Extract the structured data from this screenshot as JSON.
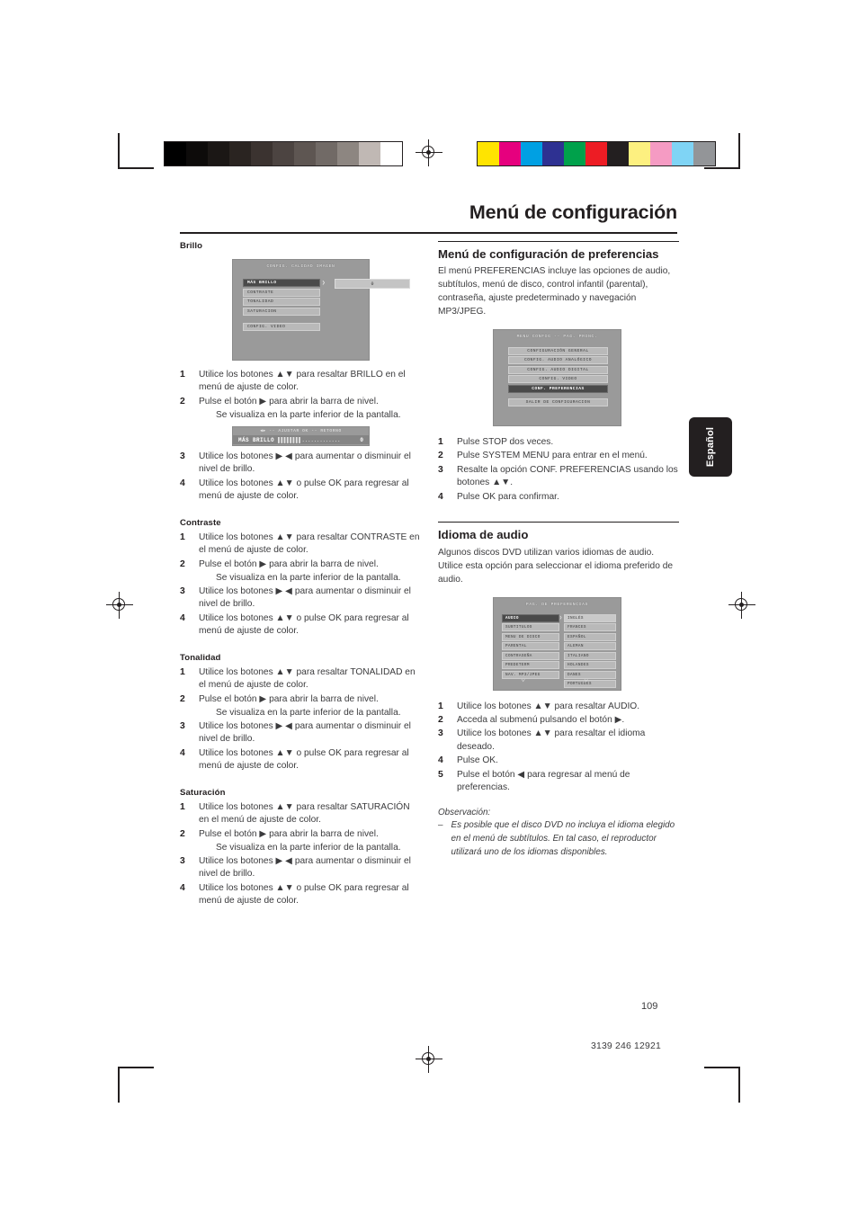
{
  "page": {
    "title": "Menú de configuración",
    "side_tab": "Español",
    "page_number": "109",
    "doc_number": "3139 246 12921"
  },
  "calibration": {
    "gray_bar": [
      "#000000",
      "#0d0b0a",
      "#1b1715",
      "#2a2421",
      "#3b3330",
      "#4c4441",
      "#5e5652",
      "#716a66",
      "#8d8681",
      "#c0b8b4",
      "#ffffff"
    ],
    "color_bar": [
      "#ffe400",
      "#e6007e",
      "#00a0e3",
      "#2e3192",
      "#00a14b",
      "#ed1c24",
      "#231f20",
      "#fdf080",
      "#f59bc3",
      "#7fd4f5",
      "#939598"
    ]
  },
  "left_column": {
    "sections": [
      {
        "heading": "Brillo",
        "figure_top": {
          "title": "CONFIG. CALIDAD IMAGEN",
          "items": [
            "MÁS BRILLO",
            "CONTRASTE",
            "TONALIDAD",
            "SATURACION"
          ],
          "selected_index": 0,
          "value": "0",
          "extra_item": "CONFIG. VIDEO"
        },
        "steps": [
          {
            "num": "1",
            "text": "Utilice los botones ▲▼ para resaltar BRILLO en el menú de ajuste de color."
          },
          {
            "num": "2",
            "text": "Pulse el botón ▶ para abrir la barra de nivel."
          }
        ],
        "substep": "Se visualiza en la parte inferior de la pantalla.",
        "figure_bar": {
          "hint": "◀▶ -- AJUSTAR     OK -- RETORNO",
          "label": "MÁS BRILLO",
          "meter": "▌▌▌▌▌▌▌▌.............",
          "value": "0"
        },
        "steps_after": [
          {
            "num": "3",
            "text": "Utilice los botones ▶ ◀ para aumentar o disminuir el nivel de brillo."
          },
          {
            "num": "4",
            "text": "Utilice los botones ▲▼ o pulse OK para regresar al menú de ajuste de color."
          }
        ]
      },
      {
        "heading": "Contraste",
        "steps": [
          {
            "num": "1",
            "text": "Utilice los botones ▲▼ para resaltar CONTRASTE en el menú de ajuste de color."
          },
          {
            "num": "2",
            "text": "Pulse el botón ▶ para abrir la barra de nivel."
          }
        ],
        "substep": "Se visualiza en la parte inferior de la pantalla.",
        "steps_after": [
          {
            "num": "3",
            "text": "Utilice los botones ▶ ◀ para aumentar o disminuir el nivel de brillo."
          },
          {
            "num": "4",
            "text": "Utilice los botones ▲▼ o pulse OK para regresar al menú de ajuste de color."
          }
        ]
      },
      {
        "heading": "Tonalidad",
        "steps": [
          {
            "num": "1",
            "text": "Utilice los botones ▲▼ para resaltar TONALIDAD en el menú de ajuste de color."
          },
          {
            "num": "2",
            "text": "Pulse el botón ▶ para abrir la barra de nivel."
          }
        ],
        "substep": "Se visualiza en la parte inferior de la pantalla.",
        "steps_after": [
          {
            "num": "3",
            "text": "Utilice los botones ▶ ◀ para aumentar o disminuir el nivel de brillo."
          },
          {
            "num": "4",
            "text": "Utilice los botones ▲▼ o pulse OK para regresar al menú de ajuste de color."
          }
        ]
      },
      {
        "heading": "Saturación",
        "steps": [
          {
            "num": "1",
            "text": "Utilice los botones ▲▼ para resaltar SATURACIÓN en el menú de ajuste de color."
          },
          {
            "num": "2",
            "text": "Pulse el botón ▶ para abrir la barra de nivel."
          }
        ],
        "substep": "Se visualiza en la parte inferior de la pantalla.",
        "steps_after": [
          {
            "num": "3",
            "text": "Utilice los botones ▶ ◀ para aumentar o disminuir el nivel de brillo."
          },
          {
            "num": "4",
            "text": "Utilice los botones ▲▼ o pulse OK para regresar al menú de ajuste de color."
          }
        ]
      }
    ]
  },
  "right_column": {
    "prefs": {
      "heading": "Menú de configuración de preferencias",
      "body": "El menú PREFERENCIAS incluye las opciones de audio, subtítulos, menú de disco, control infantil (parental), contraseña, ajuste predeterminado y navegación MP3/JPEG.",
      "figure": {
        "title": "MENU CONFIG -- PAG. PRINC.",
        "items": [
          "CONFIGURACIÓN GENERAL",
          "CONFIG. AUDIO ANALÓGICO",
          "CONFIG. AUDIO DIGITAL",
          "CONFIG. VIDEO",
          "CONF. PREFERENCIAS"
        ],
        "selected_index": 4,
        "exit_item": "SALIR DE CONFIGURACION"
      },
      "steps": [
        {
          "num": "1",
          "text": "Pulse STOP dos veces."
        },
        {
          "num": "2",
          "text": "Pulse SYSTEM MENU para entrar en el menú."
        },
        {
          "num": "3",
          "text": "Resalte la opción CONF. PREFERENCIAS usando los botones ▲▼."
        },
        {
          "num": "4",
          "text": "Pulse OK para confirmar."
        }
      ]
    },
    "audio_lang": {
      "heading": "Idioma de audio",
      "body": "Algunos discos DVD utilizan varios idiomas de audio. Utilice esta opción para seleccionar el idioma preferido de audio.",
      "figure": {
        "title": "PAG. DE PREFERENCIAS",
        "left_items": [
          "AUDIO",
          "SUBTITULOS",
          "MENU DE DISCO",
          "PARENTAL",
          "CONTRASEÑA",
          "PREDETERM",
          "NAV. MP3/JPEG"
        ],
        "left_selected_index": 0,
        "right_items": [
          "INGLÉS",
          "FRANCES",
          "ESPAÑOL",
          "ALEMAN",
          "ITALIANO",
          "HOLANDES",
          "DANES",
          "PORTUGUES"
        ],
        "right_selected_index": 0
      },
      "steps": [
        {
          "num": "1",
          "text": "Utilice los botones ▲▼ para resaltar AUDIO."
        },
        {
          "num": "2",
          "text": "Acceda al submenú pulsando el botón ▶."
        },
        {
          "num": "3",
          "text": "Utilice los botones ▲▼ para resaltar el idioma deseado."
        },
        {
          "num": "4",
          "text": "Pulse OK."
        },
        {
          "num": "5",
          "text": "Pulse el botón ◀ para regresar al menú de preferencias."
        }
      ],
      "note": {
        "label": "Observación:",
        "dash": "–",
        "text": "Es posible que el disco DVD no incluya el idioma elegido en el menú de subtítulos. En tal caso, el reproductor utilizará uno de los idiomas disponibles."
      }
    }
  }
}
